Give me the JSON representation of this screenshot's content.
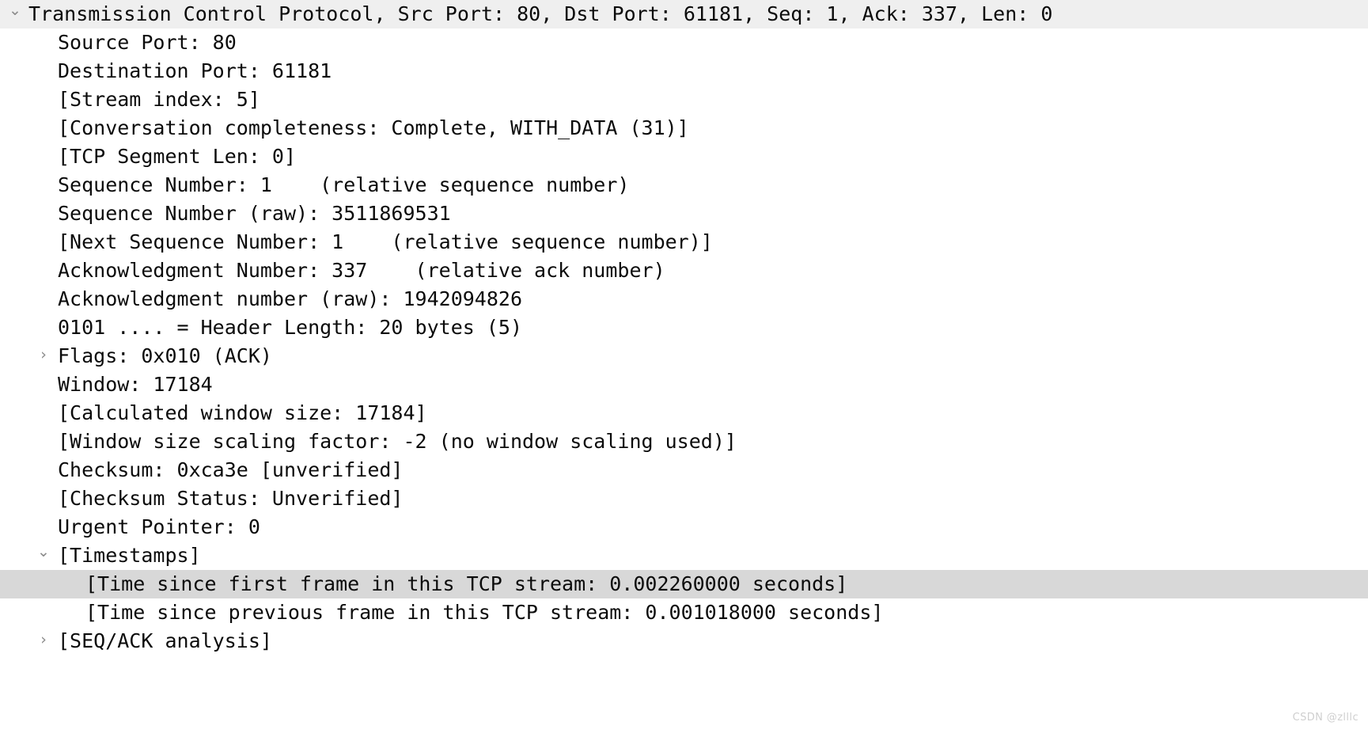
{
  "panel": {
    "name": "packet-details-tree",
    "selection_background": "#d8d8d8",
    "header_background": "#efefef",
    "text_color": "#0b0b0b",
    "twisty_color": "#8a8a8a"
  },
  "watermark": {
    "text": "CSDN @zlllc"
  },
  "tree": {
    "rows": [
      {
        "label": "Transmission Control Protocol, Src Port: 80, Dst Port: 61181, Seq: 1, Ack: 337, Len: 0",
        "level": 0,
        "twisty": "open",
        "state": "header",
        "name": "tcp-protocol-root"
      },
      {
        "label": "Source Port: 80",
        "level": 1,
        "twisty": "none",
        "state": "normal",
        "name": "field-source-port"
      },
      {
        "label": "Destination Port: 61181",
        "level": 1,
        "twisty": "none",
        "state": "normal",
        "name": "field-destination-port"
      },
      {
        "label": "[Stream index: 5]",
        "level": 1,
        "twisty": "none",
        "state": "normal",
        "name": "field-stream-index"
      },
      {
        "label": "[Conversation completeness: Complete, WITH_DATA (31)]",
        "level": 1,
        "twisty": "none",
        "state": "normal",
        "name": "field-conversation-completeness"
      },
      {
        "label": "[TCP Segment Len: 0]",
        "level": 1,
        "twisty": "none",
        "state": "normal",
        "name": "field-tcp-segment-len"
      },
      {
        "label": "Sequence Number: 1    (relative sequence number)",
        "level": 1,
        "twisty": "none",
        "state": "normal",
        "name": "field-sequence-number"
      },
      {
        "label": "Sequence Number (raw): 3511869531",
        "level": 1,
        "twisty": "none",
        "state": "normal",
        "name": "field-sequence-number-raw"
      },
      {
        "label": "[Next Sequence Number: 1    (relative sequence number)]",
        "level": 1,
        "twisty": "none",
        "state": "normal",
        "name": "field-next-sequence-number"
      },
      {
        "label": "Acknowledgment Number: 337    (relative ack number)",
        "level": 1,
        "twisty": "none",
        "state": "normal",
        "name": "field-acknowledgment-number"
      },
      {
        "label": "Acknowledgment number (raw): 1942094826",
        "level": 1,
        "twisty": "none",
        "state": "normal",
        "name": "field-acknowledgment-number-raw"
      },
      {
        "label": "0101 .... = Header Length: 20 bytes (5)",
        "level": 1,
        "twisty": "none",
        "state": "normal",
        "name": "field-header-length"
      },
      {
        "label": "Flags: 0x010 (ACK)",
        "level": 1,
        "twisty": "closed",
        "state": "normal",
        "name": "field-flags"
      },
      {
        "label": "Window: 17184",
        "level": 1,
        "twisty": "none",
        "state": "normal",
        "name": "field-window"
      },
      {
        "label": "[Calculated window size: 17184]",
        "level": 1,
        "twisty": "none",
        "state": "normal",
        "name": "field-calculated-window-size"
      },
      {
        "label": "[Window size scaling factor: -2 (no window scaling used)]",
        "level": 1,
        "twisty": "none",
        "state": "normal",
        "name": "field-window-size-scaling-factor"
      },
      {
        "label": "Checksum: 0xca3e [unverified]",
        "level": 1,
        "twisty": "none",
        "state": "normal",
        "name": "field-checksum"
      },
      {
        "label": "[Checksum Status: Unverified]",
        "level": 1,
        "twisty": "none",
        "state": "normal",
        "name": "field-checksum-status"
      },
      {
        "label": "Urgent Pointer: 0",
        "level": 1,
        "twisty": "none",
        "state": "normal",
        "name": "field-urgent-pointer"
      },
      {
        "label": "[Timestamps]",
        "level": 1,
        "twisty": "open",
        "state": "normal",
        "name": "field-timestamps-group"
      },
      {
        "label": "[Time since first frame in this TCP stream: 0.002260000 seconds]",
        "level": 2,
        "twisty": "none",
        "state": "selected",
        "name": "field-time-since-first-frame"
      },
      {
        "label": "[Time since previous frame in this TCP stream: 0.001018000 seconds]",
        "level": 2,
        "twisty": "none",
        "state": "normal",
        "name": "field-time-since-previous-frame"
      },
      {
        "label": "[SEQ/ACK analysis]",
        "level": 1,
        "twisty": "closed",
        "state": "normal",
        "name": "field-seq-ack-analysis"
      }
    ]
  }
}
